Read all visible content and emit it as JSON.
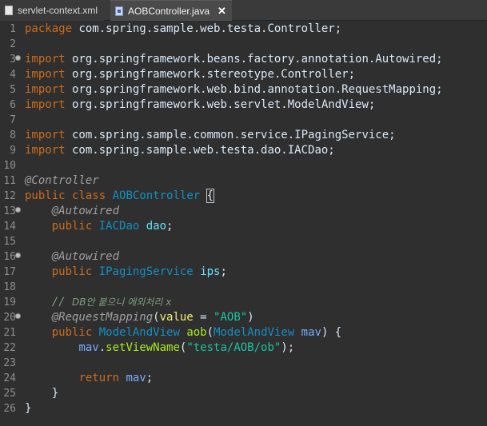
{
  "tabs": [
    {
      "label": "servlet-context.xml",
      "active": false,
      "icon": "xml-file-icon"
    },
    {
      "label": "AOBController.java",
      "active": true,
      "icon": "java-file-icon"
    }
  ],
  "tab_close_glyph": "✕",
  "colors": {
    "background": "#2f2f2f",
    "keyword": "#cc6c1d",
    "type": "#1290c3",
    "string": "#17c6a3",
    "annotation": "#a0a0a0"
  },
  "code": {
    "lines": [
      {
        "n": "1",
        "fold": false,
        "segments": [
          [
            "kw",
            "package"
          ],
          [
            "pl",
            " com.spring.sample.web.testa.Controller;"
          ]
        ]
      },
      {
        "n": "2",
        "fold": false,
        "segments": []
      },
      {
        "n": "3",
        "fold": true,
        "segments": [
          [
            "kw",
            "import"
          ],
          [
            "pl",
            " org.springframework.beans.factory.annotation.Autowired;"
          ]
        ]
      },
      {
        "n": "4",
        "fold": false,
        "segments": [
          [
            "kw",
            "import"
          ],
          [
            "pl",
            " org.springframework.stereotype.Controller;"
          ]
        ]
      },
      {
        "n": "5",
        "fold": false,
        "segments": [
          [
            "kw",
            "import"
          ],
          [
            "pl",
            " org.springframework.web.bind.annotation.RequestMapping;"
          ]
        ]
      },
      {
        "n": "6",
        "fold": false,
        "segments": [
          [
            "kw",
            "import"
          ],
          [
            "pl",
            " org.springframework.web.servlet.ModelAndView;"
          ]
        ]
      },
      {
        "n": "7",
        "fold": false,
        "segments": []
      },
      {
        "n": "8",
        "fold": false,
        "segments": [
          [
            "kw",
            "import"
          ],
          [
            "pl",
            " com.spring.sample.common.service.IPagingService;"
          ]
        ]
      },
      {
        "n": "9",
        "fold": false,
        "segments": [
          [
            "kw",
            "import"
          ],
          [
            "pl",
            " com.spring.sample.web.testa.dao.IACDao;"
          ]
        ]
      },
      {
        "n": "10",
        "fold": false,
        "segments": []
      },
      {
        "n": "11",
        "fold": false,
        "segments": [
          [
            "an",
            "@Controller"
          ]
        ]
      },
      {
        "n": "12",
        "fold": false,
        "segments": [
          [
            "kw",
            "public"
          ],
          [
            "pl",
            " "
          ],
          [
            "kw",
            "class"
          ],
          [
            "pl",
            " "
          ],
          [
            "ty",
            "AOBController"
          ],
          [
            "pl",
            " "
          ],
          [
            "brace",
            "{"
          ]
        ]
      },
      {
        "n": "13",
        "fold": true,
        "segments": [
          [
            "pl",
            "    "
          ],
          [
            "an",
            "@Autowired"
          ]
        ]
      },
      {
        "n": "14",
        "fold": false,
        "segments": [
          [
            "pl",
            "    "
          ],
          [
            "kw",
            "public"
          ],
          [
            "pl",
            " "
          ],
          [
            "ty",
            "IACDao"
          ],
          [
            "pl",
            " "
          ],
          [
            "fd",
            "dao"
          ],
          [
            "pl",
            ";"
          ]
        ]
      },
      {
        "n": "15",
        "fold": false,
        "segments": []
      },
      {
        "n": "16",
        "fold": true,
        "segments": [
          [
            "pl",
            "    "
          ],
          [
            "an",
            "@Autowired"
          ]
        ]
      },
      {
        "n": "17",
        "fold": false,
        "segments": [
          [
            "pl",
            "    "
          ],
          [
            "kw",
            "public"
          ],
          [
            "pl",
            " "
          ],
          [
            "ty",
            "IPagingService"
          ],
          [
            "pl",
            " "
          ],
          [
            "fd",
            "ips"
          ],
          [
            "pl",
            ";"
          ]
        ]
      },
      {
        "n": "18",
        "fold": false,
        "segments": []
      },
      {
        "n": "19",
        "fold": false,
        "segments": [
          [
            "pl",
            "    "
          ],
          [
            "cm",
            "// "
          ],
          [
            "cmko",
            "DB안 붙으니 에외처리 x"
          ]
        ]
      },
      {
        "n": "20",
        "fold": true,
        "segments": [
          [
            "pl",
            "    "
          ],
          [
            "an",
            "@RequestMapping"
          ],
          [
            "pl",
            "("
          ],
          [
            "mv",
            "value"
          ],
          [
            "pl",
            " = "
          ],
          [
            "st",
            "\"AOB\""
          ],
          [
            "pl",
            ")"
          ]
        ]
      },
      {
        "n": "21",
        "fold": false,
        "segments": [
          [
            "pl",
            "    "
          ],
          [
            "kw",
            "public"
          ],
          [
            "pl",
            " "
          ],
          [
            "ty",
            "ModelAndView"
          ],
          [
            "pl",
            " "
          ],
          [
            "me",
            "aob"
          ],
          [
            "pl",
            "("
          ],
          [
            "ty",
            "ModelAndView"
          ],
          [
            "pl",
            " "
          ],
          [
            "pa",
            "mav"
          ],
          [
            "pl",
            ") {"
          ]
        ]
      },
      {
        "n": "22",
        "fold": false,
        "segments": [
          [
            "pl",
            "        "
          ],
          [
            "pa",
            "mav"
          ],
          [
            "pl",
            "."
          ],
          [
            "me",
            "setViewName"
          ],
          [
            "pl",
            "("
          ],
          [
            "st",
            "\"testa/AOB/ob\""
          ],
          [
            "pl",
            ");"
          ]
        ]
      },
      {
        "n": "23",
        "fold": false,
        "segments": []
      },
      {
        "n": "24",
        "fold": false,
        "segments": [
          [
            "pl",
            "        "
          ],
          [
            "kw",
            "return"
          ],
          [
            "pl",
            " "
          ],
          [
            "pa",
            "mav"
          ],
          [
            "pl",
            ";"
          ]
        ]
      },
      {
        "n": "25",
        "fold": false,
        "segments": [
          [
            "pl",
            "    }"
          ]
        ]
      },
      {
        "n": "26",
        "fold": false,
        "segments": [
          [
            "pl",
            "}"
          ]
        ]
      }
    ]
  }
}
